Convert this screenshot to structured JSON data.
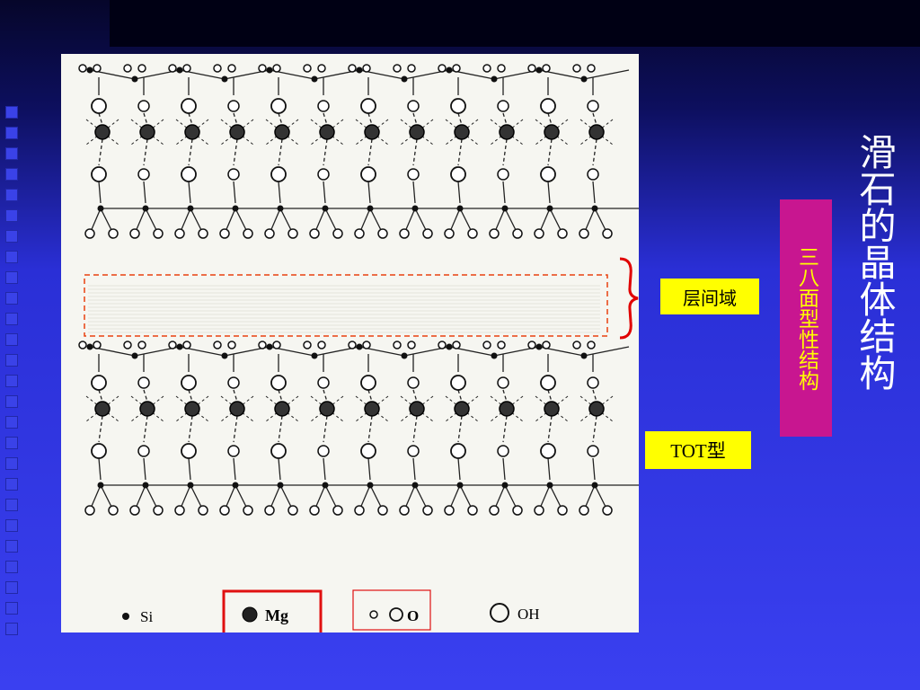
{
  "slide": {
    "title": "滑石的晶体结构",
    "side_label": "三八面型性结构",
    "interlayer_label": "层间域",
    "tot_label": "TOT型"
  },
  "legend": [
    {
      "symbol": "si-dot",
      "label": "Si"
    },
    {
      "symbol": "mg-atom",
      "label": "Mg"
    },
    {
      "symbol": "o-atom",
      "label": "O"
    },
    {
      "symbol": "oh-atom",
      "label": "OH"
    }
  ],
  "colors": {
    "highlight_yellow": "#ffff00",
    "magenta_box": "#c81690",
    "dashed_box": "#e84010",
    "brace": "#e00000",
    "mg_legend_box": "#e01010"
  }
}
